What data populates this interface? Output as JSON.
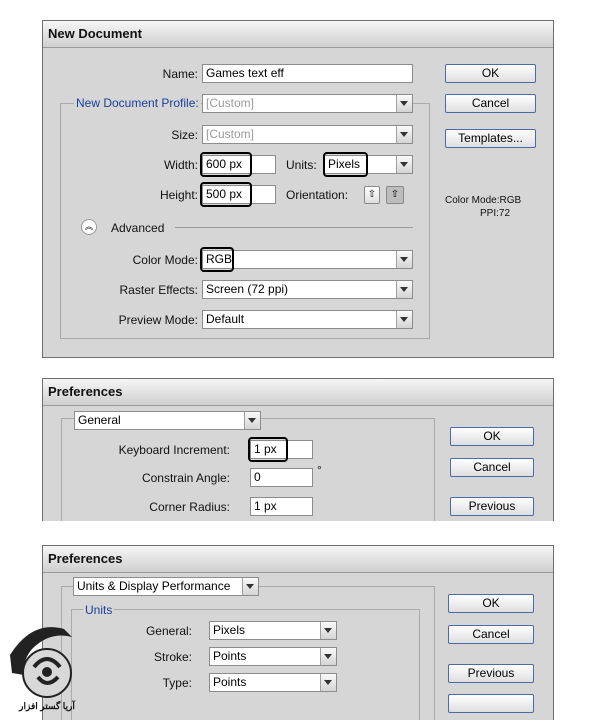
{
  "new_document": {
    "title": "New Document",
    "name_label": "Name:",
    "name_value": "Games text eff",
    "profile_label": "New Document Profile:",
    "profile_value": "[Custom]",
    "size_label": "Size:",
    "size_value": "[Custom]",
    "width_label": "Width:",
    "width_value": "600 px",
    "units_label": "Units:",
    "units_value": "Pixels",
    "height_label": "Height:",
    "height_value": "500 px",
    "orientation_label": "Orientation:",
    "advanced_label": "Advanced",
    "color_mode_label": "Color Mode:",
    "color_mode_value": "RGB",
    "raster_label": "Raster Effects:",
    "raster_value": "Screen (72 ppi)",
    "preview_label": "Preview Mode:",
    "preview_value": "Default",
    "ok": "OK",
    "cancel": "Cancel",
    "templates": "Templates...",
    "info_color_mode": "Color Mode:RGB",
    "info_ppi": "PPI:72"
  },
  "preferences_general": {
    "title": "Preferences",
    "section": "General",
    "keyboard_increment_label": "Keyboard Increment:",
    "keyboard_increment_value": "1 px",
    "constrain_angle_label": "Constrain Angle:",
    "constrain_angle_value": "0",
    "degree_symbol": "°",
    "corner_radius_label": "Corner Radius:",
    "corner_radius_value": "1 px",
    "ok": "OK",
    "cancel": "Cancel",
    "previous": "Previous"
  },
  "preferences_units": {
    "title": "Preferences",
    "section": "Units & Display Performance",
    "units_group": "Units",
    "general_label": "General:",
    "general_value": "Pixels",
    "stroke_label": "Stroke:",
    "stroke_value": "Points",
    "type_label": "Type:",
    "type_value": "Points",
    "ok": "OK",
    "cancel": "Cancel",
    "previous": "Previous"
  },
  "watermark": {
    "text": "آریا گستر افزار"
  },
  "colors": {
    "dialog_bg": "#d6d6d6",
    "group_label": "#1a3f9c",
    "button_border": "#4a6aa8"
  }
}
